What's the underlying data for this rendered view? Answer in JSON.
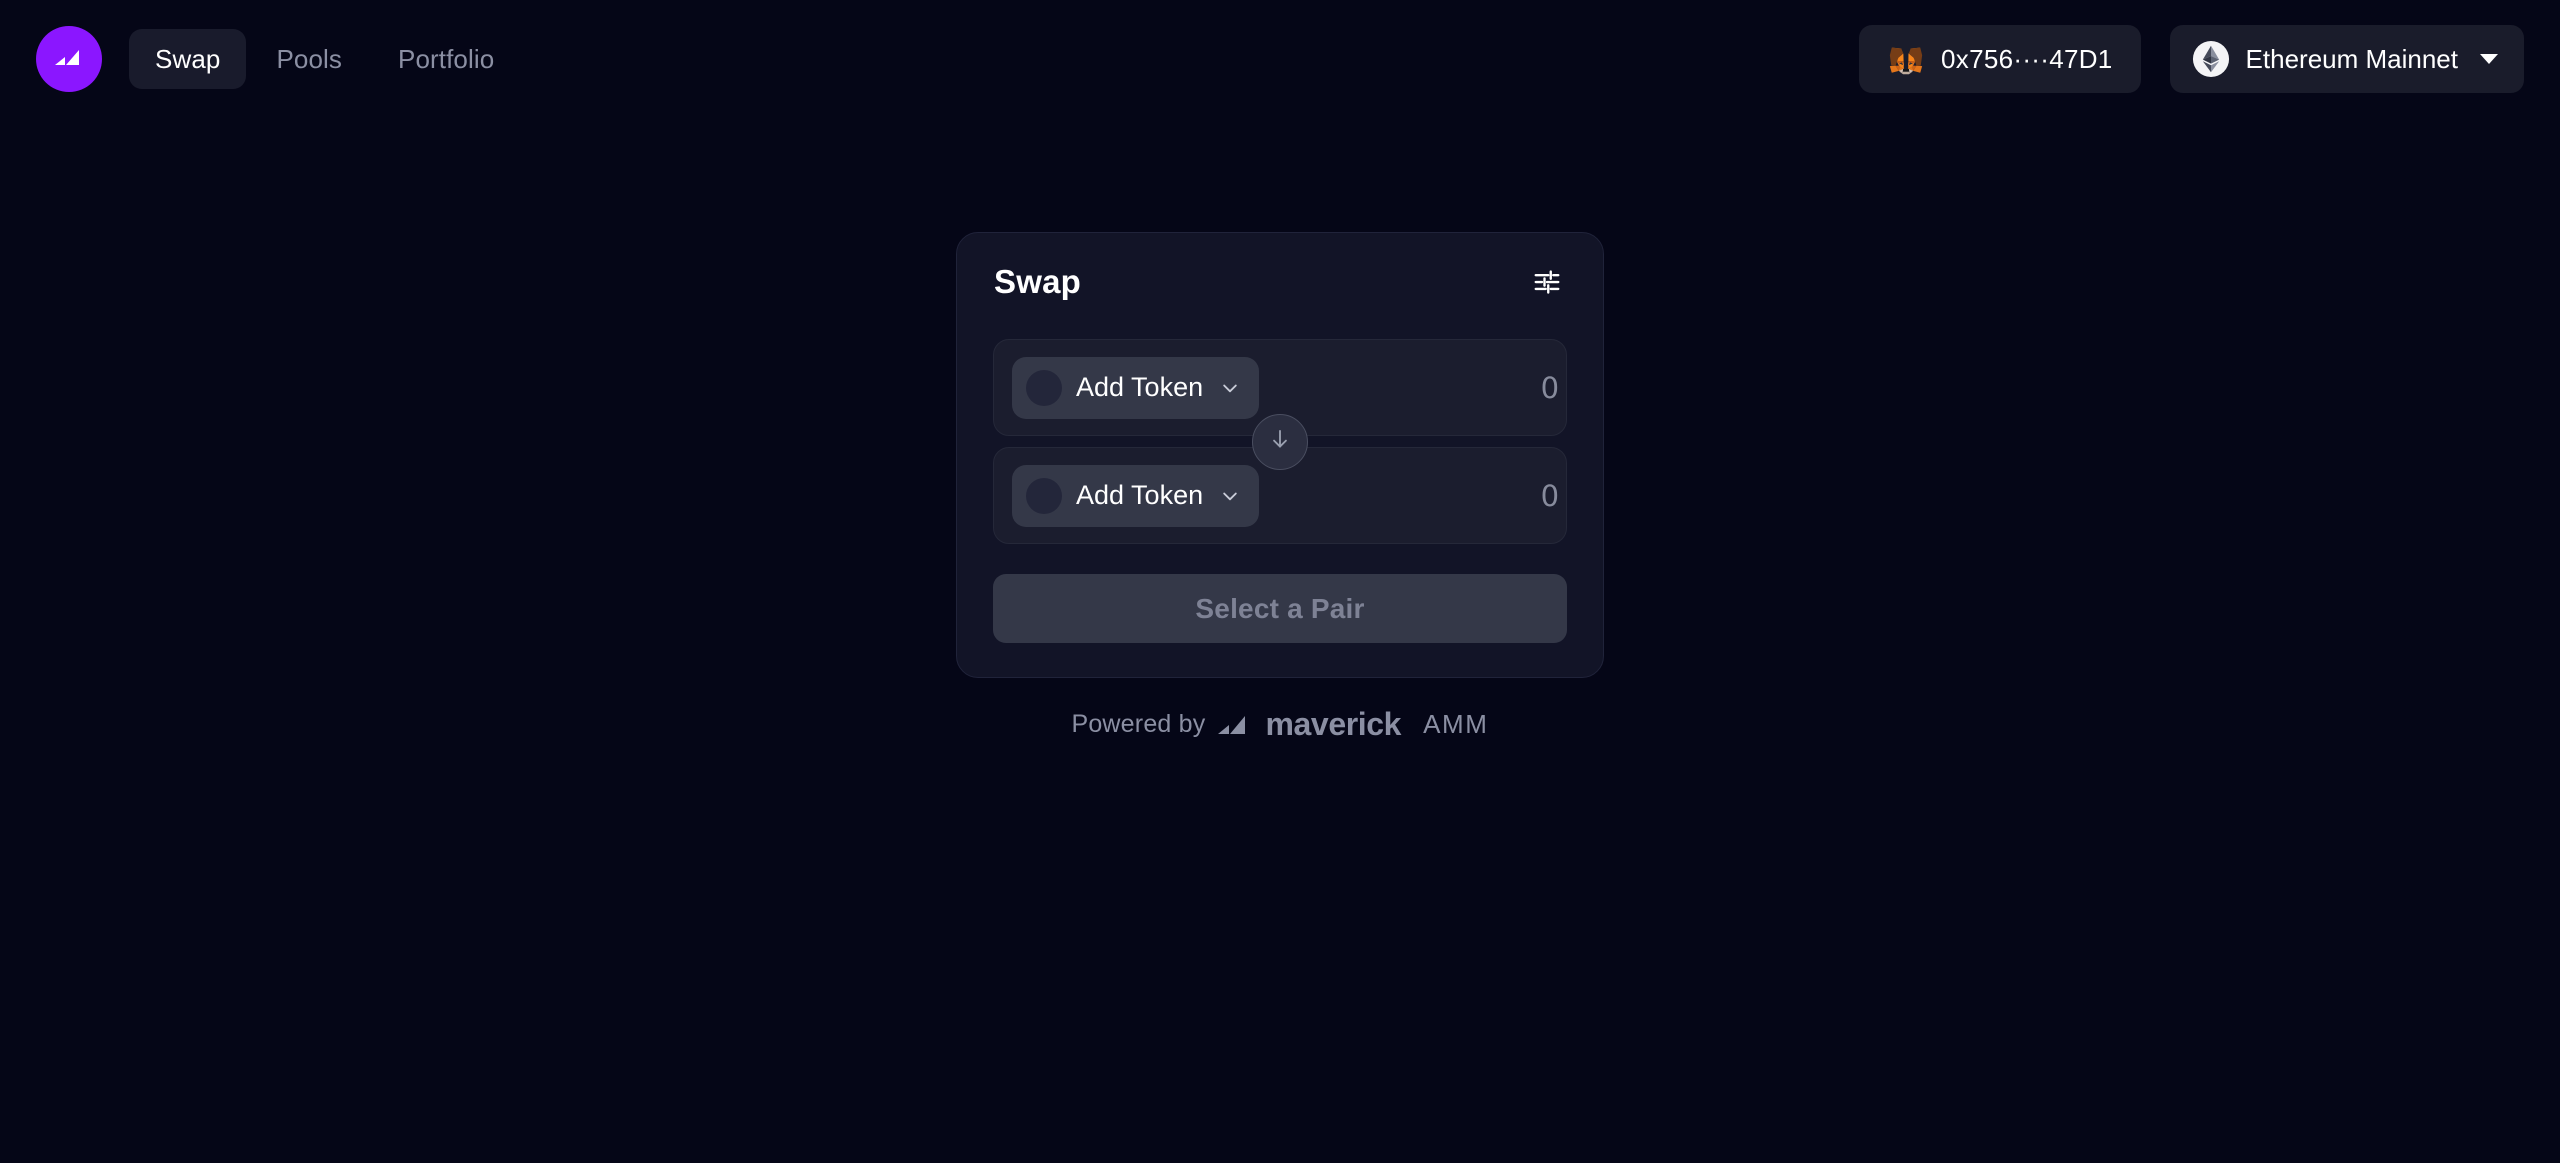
{
  "theme": {
    "page_bg": "#050617",
    "card_bg": "#121427",
    "row_bg": "#1b1d2e",
    "pill_bg": "#343848",
    "brand_purple": "#8b16ff",
    "text_primary": "#ffffff",
    "text_muted": "#8b8fa3"
  },
  "header": {
    "logo_icon": "maverick-logo-icon",
    "nav": [
      {
        "label": "Swap",
        "active": true
      },
      {
        "label": "Pools",
        "active": false
      },
      {
        "label": "Portfolio",
        "active": false
      }
    ],
    "wallet": {
      "icon": "metamask-fox-icon",
      "address": "0x756····47D1"
    },
    "network": {
      "icon": "ethereum-icon",
      "name": "Ethereum Mainnet",
      "caret": "caret-down-icon"
    }
  },
  "swap_card": {
    "title": "Swap",
    "settings_icon": "sliders-settings-icon",
    "swap_direction_icon": "arrow-down-icon",
    "rows": [
      {
        "token_label": "Add Token",
        "token_logo": "token-placeholder-icon",
        "chevron": "chevron-down-icon",
        "amount_value": "",
        "amount_placeholder": "0"
      },
      {
        "token_label": "Add Token",
        "token_logo": "token-placeholder-icon",
        "chevron": "chevron-down-icon",
        "amount_value": "",
        "amount_placeholder": "0"
      }
    ],
    "action_button": {
      "label": "Select a Pair",
      "disabled": true
    }
  },
  "footer": {
    "powered_by": "Powered by",
    "brand_mark_icon": "maverick-mark-icon",
    "brand_name": "maverick",
    "brand_suffix": "AMM"
  }
}
